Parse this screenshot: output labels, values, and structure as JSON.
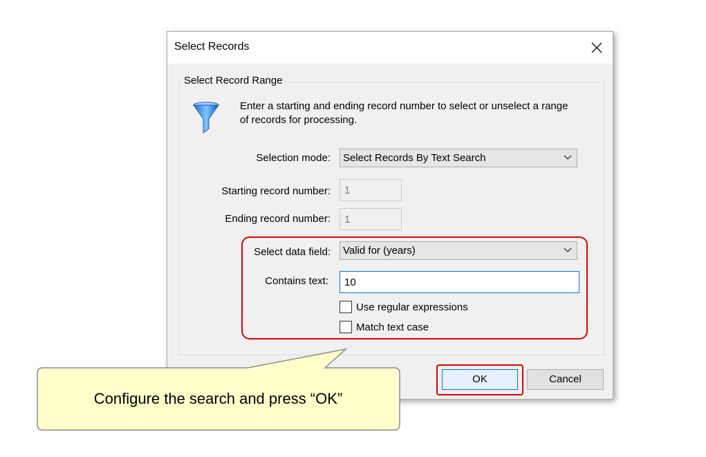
{
  "dialog": {
    "title": "Select Records",
    "close_icon": "close-icon",
    "group_title": "Select Record Range",
    "funnel_icon": "funnel-icon",
    "description": "Enter a starting and ending record number to select or unselect a range of records for processing.",
    "selection_mode": {
      "label": "Selection mode:",
      "value": "Select Records By Text Search"
    },
    "starting_record": {
      "label": "Starting record number:",
      "value": "1"
    },
    "ending_record": {
      "label": "Ending record number:",
      "value": "1"
    },
    "data_field": {
      "label": "Select data field:",
      "value": "Valid for (years)"
    },
    "contains_text": {
      "label": "Contains text:",
      "value": "10"
    },
    "use_regex": {
      "label": "Use regular expressions",
      "checked": false
    },
    "match_case": {
      "label": "Match text case",
      "checked": false
    },
    "ok_label": "OK",
    "cancel_label": "Cancel"
  },
  "callout": {
    "text": "Configure the search and press “OK”"
  },
  "colors": {
    "highlight": "#e00000",
    "callout_fill": "#ffffcc",
    "focus_border": "#0078d7"
  }
}
